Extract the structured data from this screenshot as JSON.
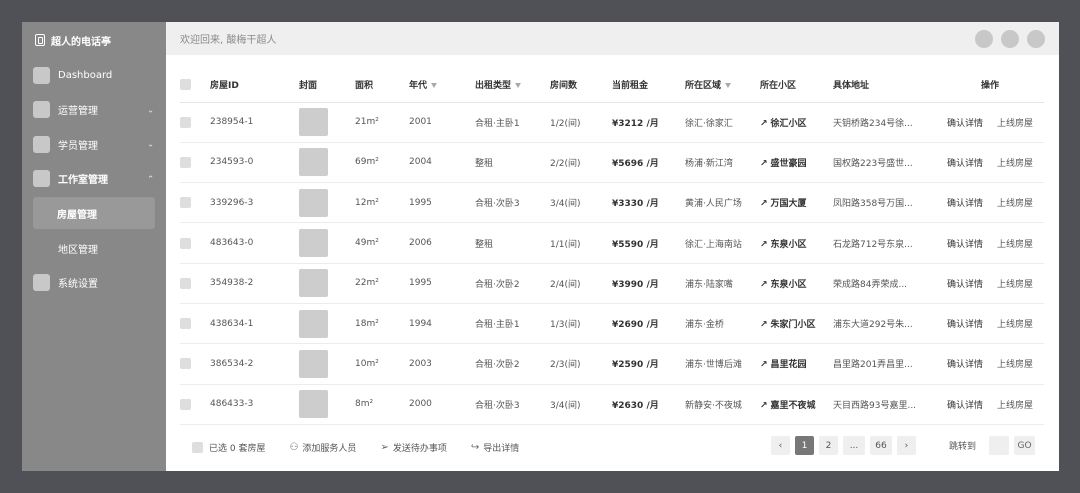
{
  "sidebar": {
    "brand": "超人的电话亭",
    "items": [
      {
        "label": "Dashboard"
      },
      {
        "label": "运营管理",
        "chevron": "chevron-down"
      },
      {
        "label": "学员管理",
        "chevron": "chevron-down"
      },
      {
        "label": "工作室管理",
        "chevron": "chevron-up",
        "sub": [
          "房屋管理",
          "地区管理"
        ]
      },
      {
        "label": "系统设置"
      }
    ]
  },
  "topbar": {
    "welcome": "欢迎回来, 酸梅干超人"
  },
  "table": {
    "headers": [
      "房屋ID",
      "封面",
      "面积",
      "年代",
      "出租类型",
      "房间数",
      "当前租金",
      "所在区域",
      "所在小区",
      "具体地址",
      "操作"
    ],
    "rows": [
      {
        "id": "238954-1",
        "area": "21m²",
        "year": "2001",
        "type": "合租·主卧1",
        "rooms": "1/2(间)",
        "rent": "¥3212 /月",
        "region": "徐汇·徐家汇",
        "community": "徐汇小区",
        "address": "天钥桥路234号徐...",
        "op1": "确认详情",
        "op2": "上线房屋"
      },
      {
        "id": "234593-0",
        "area": "69m²",
        "year": "2004",
        "type": "整租",
        "rooms": "2/2(间)",
        "rent": "¥5696 /月",
        "region": "杨浦·新江湾",
        "community": "盛世豪园",
        "address": "国权路223号盛世...",
        "op1": "确认详情",
        "op2": "上线房屋"
      },
      {
        "id": "339296-3",
        "area": "12m²",
        "year": "1995",
        "type": "合租·次卧3",
        "rooms": "3/4(间)",
        "rent": "¥3330 /月",
        "region": "黄浦·人民广场",
        "community": "万国大厦",
        "address": "凤阳路358号万国...",
        "op1": "确认详情",
        "op2": "上线房屋"
      },
      {
        "id": "483643-0",
        "area": "49m²",
        "year": "2006",
        "type": "整租",
        "rooms": "1/1(间)",
        "rent": "¥5590 /月",
        "region": "徐汇·上海南站",
        "community": "东泉小区",
        "address": "石龙路712号东泉...",
        "op1": "确认详情",
        "op2": "上线房屋"
      },
      {
        "id": "354938-2",
        "area": "22m²",
        "year": "1995",
        "type": "合租·次卧2",
        "rooms": "2/4(间)",
        "rent": "¥3990 /月",
        "region": "浦东·陆家嘴",
        "community": "东泉小区",
        "address": "荣成路84弄荣成...",
        "op1": "确认详情",
        "op2": "上线房屋"
      },
      {
        "id": "438634-1",
        "area": "18m²",
        "year": "1994",
        "type": "合租·主卧1",
        "rooms": "1/3(间)",
        "rent": "¥2690 /月",
        "region": "浦东·金桥",
        "community": "朱家门小区",
        "address": "浦东大道292号朱...",
        "op1": "确认详情",
        "op2": "上线房屋"
      },
      {
        "id": "386534-2",
        "area": "10m²",
        "year": "2003",
        "type": "合租·次卧2",
        "rooms": "2/3(间)",
        "rent": "¥2590 /月",
        "region": "浦东·世博后滩",
        "community": "昌里花园",
        "address": "昌里路201弄昌里...",
        "op1": "确认详情",
        "op2": "上线房屋"
      },
      {
        "id": "486433-3",
        "area": "8m²",
        "year": "2000",
        "type": "合租·次卧3",
        "rooms": "3/4(间)",
        "rent": "¥2630 /月",
        "region": "新静安·不夜城",
        "community": "嘉里不夜城",
        "address": "天目西路93号嘉里...",
        "op1": "确认详情",
        "op2": "上线房屋"
      }
    ]
  },
  "footer": {
    "selected": "已选 0 套房屋",
    "actions": [
      "添加服务人员",
      "发送待办事项",
      "导出详情"
    ],
    "pager": {
      "prev": "‹",
      "pages": [
        "1",
        "2",
        "...",
        "66"
      ],
      "next": "›",
      "jump_label": "跳转到",
      "go": "GO"
    }
  }
}
